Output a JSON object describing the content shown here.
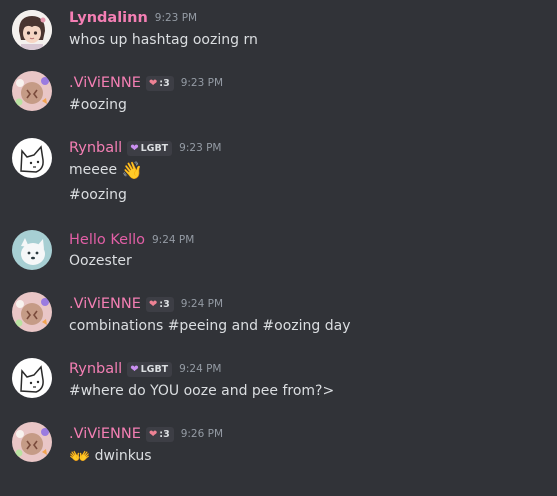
{
  "messages": [
    {
      "username": "Lyndalinn",
      "timestamp": "9:23 PM",
      "lines": [
        "whos up hashtag oozing rn"
      ]
    },
    {
      "username": ".ViViENNE",
      "tag": ":3",
      "tag_icon": "heart-icon",
      "timestamp": "9:23 PM",
      "lines": [
        "#oozing"
      ]
    },
    {
      "username": "Rynball",
      "tag": "LGBT",
      "tag_icon": "heart-icon",
      "timestamp": "9:23 PM",
      "lines": [
        "meeee",
        "#oozing"
      ],
      "emoji": "waving-hand-emoji"
    },
    {
      "username": "Hello Kello",
      "timestamp": "9:24 PM",
      "lines": [
        "Oozester"
      ]
    },
    {
      "username": ".ViViENNE",
      "tag": ":3",
      "tag_icon": "heart-icon",
      "timestamp": "9:24 PM",
      "lines": [
        "combinations #peeing and #oozing day"
      ]
    },
    {
      "username": "Rynball",
      "tag": "LGBT",
      "tag_icon": "heart-icon",
      "timestamp": "9:24 PM",
      "lines": [
        "#where do YOU ooze and pee from?>"
      ]
    },
    {
      "username": ".ViViENNE",
      "tag": ":3",
      "tag_icon": "heart-icon",
      "timestamp": "9:26 PM",
      "lines": [
        "dwinkus"
      ],
      "emoji": "open-hands-emoji"
    }
  ],
  "colors": {
    "background": "#313338",
    "text": "#dbdee1",
    "timestamp": "#949ba4",
    "username_pink": "#f47fb4",
    "username_magenta": "#e25fa6",
    "tag_background": "#3d3e45"
  }
}
